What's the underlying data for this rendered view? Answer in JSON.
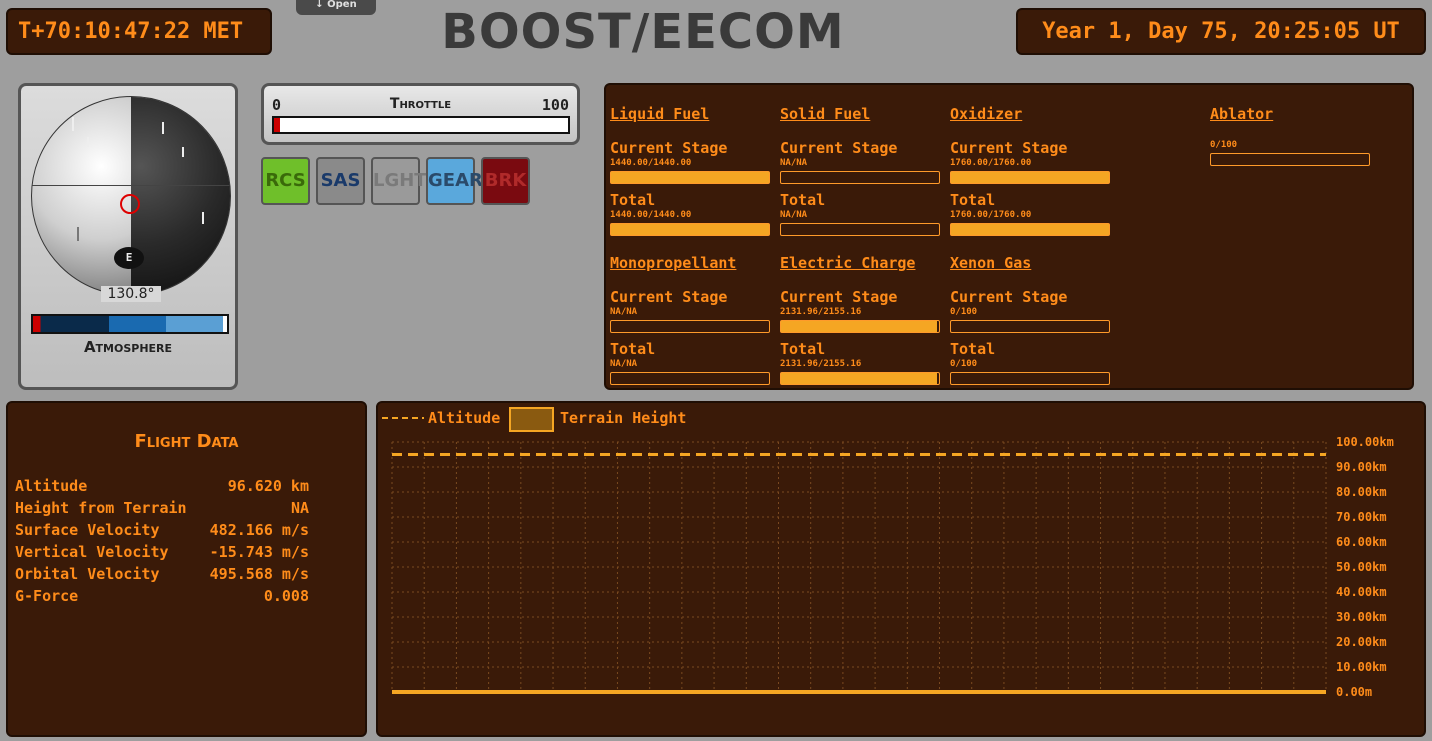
{
  "header": {
    "met": "T+70:10:47:22 MET",
    "title": "BOOST/EECOM",
    "open_tab": "↓ Open",
    "ut": "Year 1, Day 75, 20:25:05 UT"
  },
  "navball": {
    "heading": "130.8°",
    "east_label": "E",
    "atmosphere_label": "Atmosphere",
    "atmosphere_level": 0.98
  },
  "throttle": {
    "label": "Throttle",
    "min": "0",
    "max": "100",
    "value": 0.01
  },
  "toggles": [
    {
      "label": "RCS",
      "bg": "#6fbf2a",
      "color": "#3a6a0a"
    },
    {
      "label": "SAS",
      "bg": "#8a8a8a",
      "color": "#1a3a6a"
    },
    {
      "label": "LGHT",
      "bg": "#9a9a9a",
      "color": "#7a7a7a"
    },
    {
      "label": "GEAR",
      "bg": "#5aa8dc",
      "color": "#2a4a6a"
    },
    {
      "label": "BRK",
      "bg": "#7a0a10",
      "color": "#b02a2a"
    }
  ],
  "resources": {
    "current_stage_label": "Current Stage",
    "total_label": "Total",
    "items": [
      {
        "name": "Liquid Fuel",
        "stage": "1440.00/1440.00",
        "stage_fill": 1.0,
        "total": "1440.00/1440.00",
        "total_fill": 1.0
      },
      {
        "name": "Solid Fuel",
        "stage": "NA/NA",
        "stage_fill": 0,
        "total": "NA/NA",
        "total_fill": 0
      },
      {
        "name": "Oxidizer",
        "stage": "1760.00/1760.00",
        "stage_fill": 1.0,
        "total": "1760.00/1760.00",
        "total_fill": 1.0
      },
      {
        "name": "Monopropellant",
        "stage": "NA/NA",
        "stage_fill": 0,
        "total": "NA/NA",
        "total_fill": 0
      },
      {
        "name": "Electric Charge",
        "stage": "2131.96/2155.16",
        "stage_fill": 0.989,
        "total": "2131.96/2155.16",
        "total_fill": 0.989
      },
      {
        "name": "Xenon Gas",
        "stage": "0/100",
        "stage_fill": 0,
        "total": "0/100",
        "total_fill": 0
      }
    ],
    "ablator": {
      "name": "Ablator",
      "value": "0/100",
      "fill": 0
    }
  },
  "flight_data": {
    "title": "Flight Data",
    "rows": [
      {
        "label": "Altitude",
        "value": "96.620 km"
      },
      {
        "label": "Height from Terrain",
        "value": "NA"
      },
      {
        "label": "Surface Velocity",
        "value": "482.166 m/s"
      },
      {
        "label": "Vertical Velocity",
        "value": "-15.743 m/s"
      },
      {
        "label": "Orbital Velocity",
        "value": "495.568 m/s"
      },
      {
        "label": "G-Force",
        "value": "0.008"
      }
    ]
  },
  "chart_data": {
    "type": "line",
    "legend": [
      "Altitude",
      "Terrain Height"
    ],
    "y_tick_labels": [
      "100.00km",
      "90.00km",
      "80.00km",
      "70.00km",
      "60.00km",
      "50.00km",
      "40.00km",
      "30.00km",
      "20.00km",
      "10.00km",
      "0.00m"
    ],
    "ylim": [
      0,
      100
    ],
    "series": [
      {
        "name": "Altitude",
        "values": [
          95,
          95,
          95,
          95,
          95,
          95,
          95,
          95,
          95,
          95,
          95,
          95,
          95,
          95,
          95,
          95,
          95,
          95,
          95,
          95,
          95,
          95,
          95,
          95,
          95,
          95,
          95,
          95,
          95,
          95
        ],
        "style": "dashed"
      },
      {
        "name": "Terrain Height",
        "values": [
          0,
          0,
          0,
          0,
          0,
          0,
          0,
          0,
          0,
          0,
          0,
          0,
          0,
          0,
          0,
          0,
          0,
          0,
          0,
          0,
          0,
          0,
          0,
          0,
          0,
          0,
          0,
          0,
          0,
          0
        ],
        "style": "area"
      }
    ],
    "grid": true,
    "legend_position": "top-left",
    "colors": {
      "line": "#f5a623",
      "area_fill": "#8a5a10"
    }
  }
}
